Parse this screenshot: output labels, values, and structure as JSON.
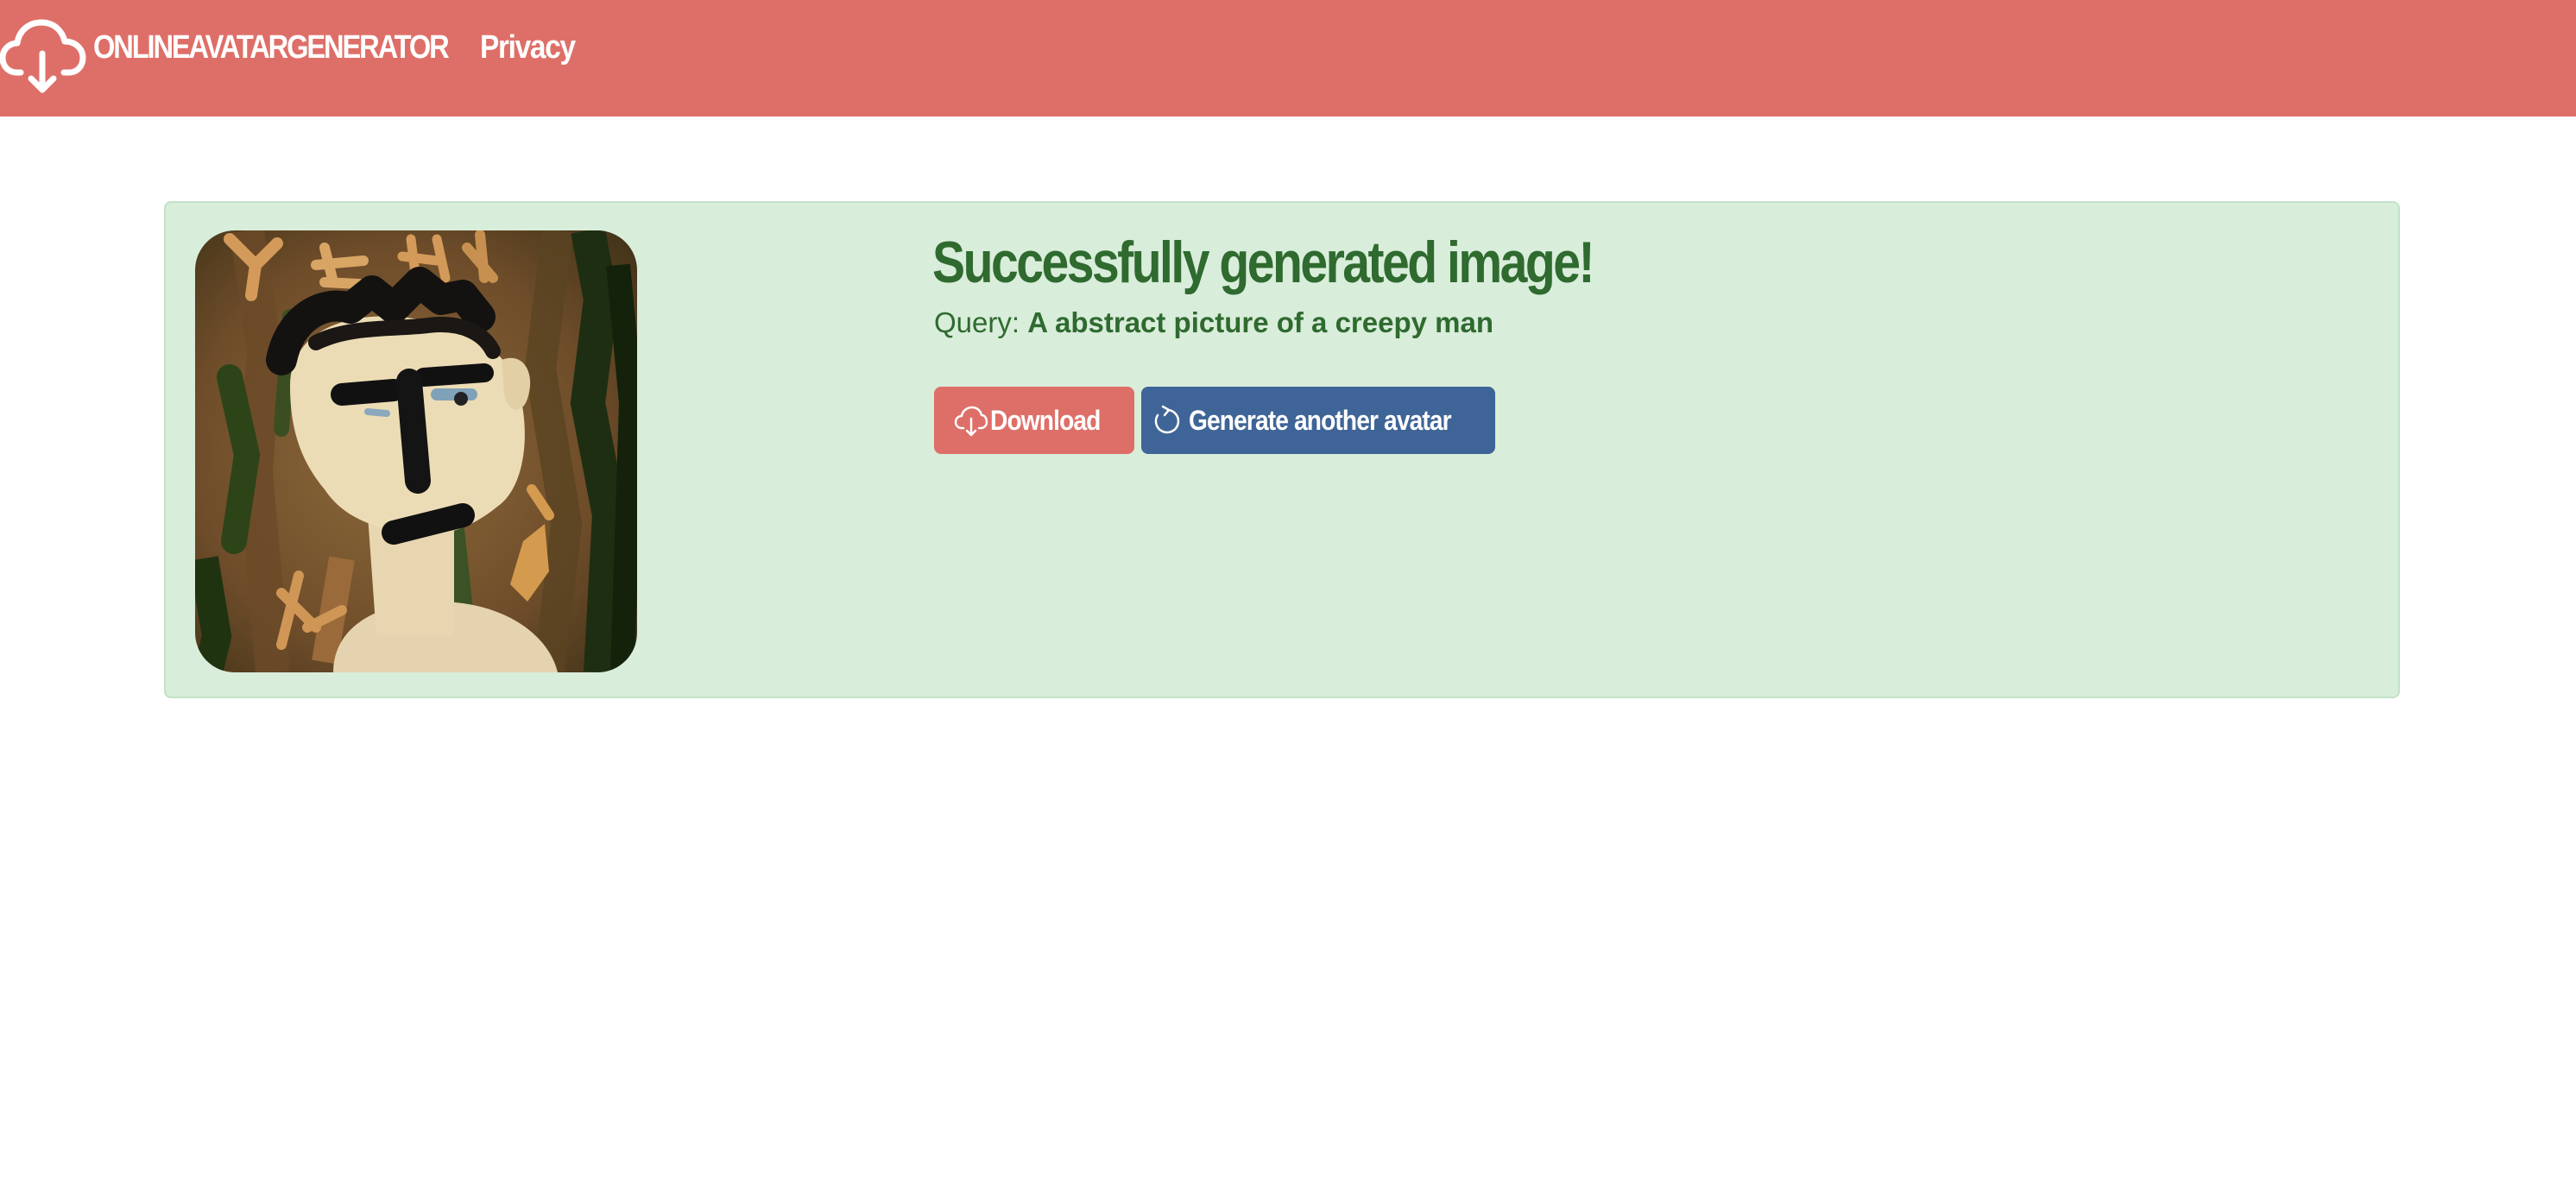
{
  "navbar": {
    "brand_text": "ONLINEAVATARGENERATOR",
    "brand_icon": "cloud-download-icon",
    "links": [
      {
        "label": "Privacy"
      }
    ],
    "background_color": "#de6f68"
  },
  "result": {
    "title": "Successfully generated image!",
    "query_label": "Query:",
    "query_value": "A abstract picture of a creepy man",
    "image_alt": "Generated avatar",
    "card_background": "#d9eddb",
    "text_color": "#2f6a2f",
    "buttons": {
      "download_label": "Download",
      "download_icon": "cloud-download-icon",
      "download_color": "#de6f68",
      "generate_label": "Generate another avatar",
      "generate_icon": "refresh-icon",
      "generate_color": "#3f6497"
    }
  }
}
